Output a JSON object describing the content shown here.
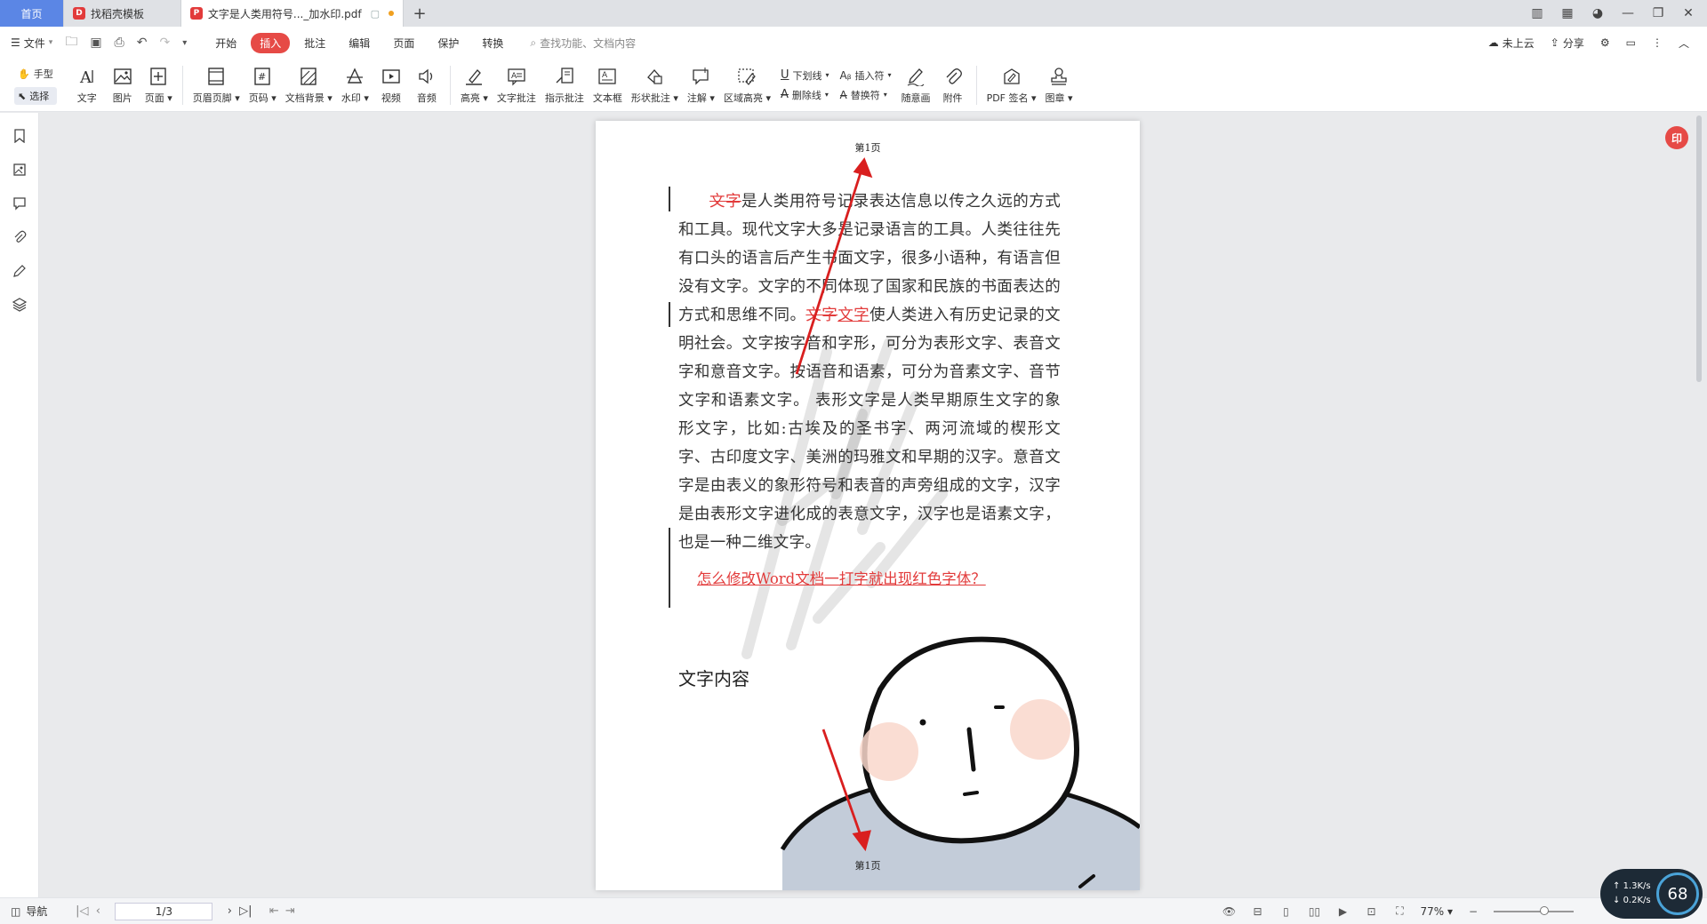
{
  "tabs": {
    "home": "首页",
    "template": "找稻壳模板",
    "doc": "文字是人类用符号..._加水印.pdf",
    "add": "+"
  },
  "menu": {
    "file": "文件",
    "tabs": [
      "开始",
      "插入",
      "批注",
      "编辑",
      "页面",
      "保护",
      "转换"
    ],
    "active_index": 1,
    "search_placeholder": "查找功能、文档内容",
    "cloud": "未上云",
    "share": "分享"
  },
  "ribbon": {
    "hand": "手型",
    "select": "选择",
    "text": "文字",
    "image": "图片",
    "page": "页面",
    "header_footer": "页眉页脚",
    "page_number": "页码",
    "doc_background": "文档背景",
    "watermark": "水印",
    "video": "视频",
    "audio": "音频",
    "highlight": "高亮",
    "text_comment": "文字批注",
    "hint_comment": "指示批注",
    "textbox": "文本框",
    "shape_comment": "形状批注",
    "annotation": "注解",
    "area_highlight": "区域高亮",
    "underline": "下划线",
    "strikethrough": "删除线",
    "insert_symbol": "插入符",
    "replace_symbol": "替换符",
    "freehand": "随意画",
    "attachment": "附件",
    "pdf_sign": "PDF 签名",
    "stamp": "图章"
  },
  "document": {
    "header": "第1页",
    "footer": "第1页",
    "para_strike1": "文字",
    "para_part1": "是人类用符号记录表达信息以传之久远的方式和工具。现代文字大多是记录语言的工具。人类往往先有口头的语言后产生书面文字，很多小语种，有语言但没有文字。文字的不同体现了国家和民族的书面表达的方式和思维不同。",
    "para_strike2": "文字",
    "para_under": "文字",
    "para_part2": "使人类进入有历史记录的文明社会。文字按字音和字形，可分为表形文字、表音文字和意音文字。按语音和语素，可分为音素文字、音节文字和语素文字。 表形文字是人类早期原生文字的象形文字，比如:古埃及的圣书字、两河流域的楔形文字、古印度文字、美洲的玛雅文和早期的汉字。意音文字是由表义的象形符号和表音的声旁组成的文字，汉字是由表形文字进化成的表意文字，汉字也是语素文字，也是一种二维文字。",
    "link": "怎么修改Word文档一打字就出现红色字体？",
    "section_title": "文字内容"
  },
  "status": {
    "nav": "导航",
    "page_indicator": "1/3",
    "zoom": "77%"
  },
  "net_widget": {
    "up": "1.3K/s",
    "down": "0.2K/s",
    "percent": "68"
  },
  "colors": {
    "accent": "#e64a46",
    "home_tab": "#5b86e5",
    "annotation_red": "#e23b3b"
  }
}
